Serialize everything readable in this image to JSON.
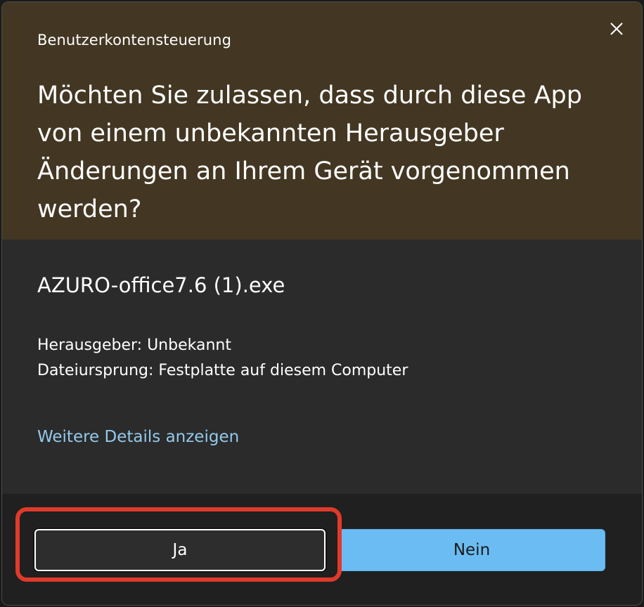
{
  "window": {
    "title": "Benutzerkontensteuerung"
  },
  "header": {
    "question": "Möchten Sie zulassen, dass durch diese App von einem unbekannten Herausgeber Änderungen an Ihrem Gerät vorgenommen werden?"
  },
  "app": {
    "name": "AZURO-office7.6 (1).exe",
    "publisher": "Herausgeber: Unbekannt",
    "origin": "Dateiursprung: Festplatte auf diesem Computer",
    "details_link": "Weitere Details anzeigen"
  },
  "buttons": {
    "yes": "Ja",
    "no": "Nein"
  },
  "colors": {
    "header_bg": "#433723",
    "body_bg": "#2b2b2b",
    "footer_bg": "#202020",
    "link": "#93c9eb",
    "primary_button": "#6bbcf2",
    "highlight": "#e03a2a"
  },
  "icons": {
    "close": "close-icon"
  }
}
